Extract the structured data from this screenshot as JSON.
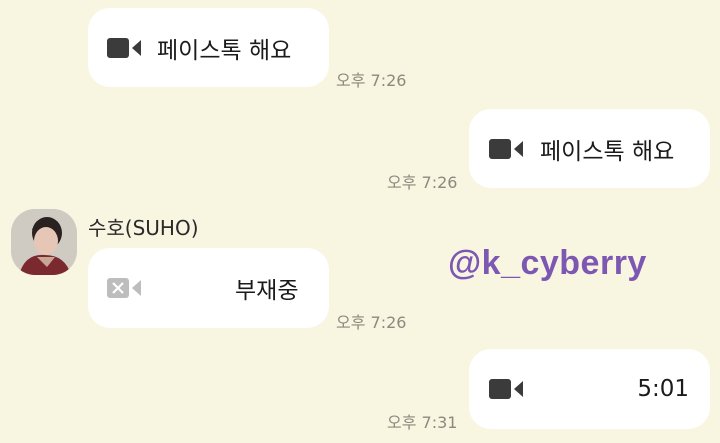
{
  "messages": [
    {
      "side": "left",
      "text": "페이스톡 해요",
      "time": "오후 7:26",
      "icon": "video-camera-icon"
    },
    {
      "side": "right",
      "text": "페이스톡 해요",
      "time": "오후 7:26",
      "icon": "video-camera-icon"
    },
    {
      "side": "left",
      "sender": "수호(SUHO)",
      "text": "부재중",
      "time": "오후 7:26",
      "icon": "video-camera-missed-icon"
    },
    {
      "side": "right",
      "text": "5:01",
      "time": "오후 7:31",
      "icon": "video-camera-icon"
    }
  ],
  "watermark": "@k_cyberry",
  "colors": {
    "background": "#f8f5e1",
    "bubble": "#ffffff",
    "icon": "#3b3b3b",
    "missed_icon": "#bdbdbd",
    "watermark": "#7d58b3"
  }
}
